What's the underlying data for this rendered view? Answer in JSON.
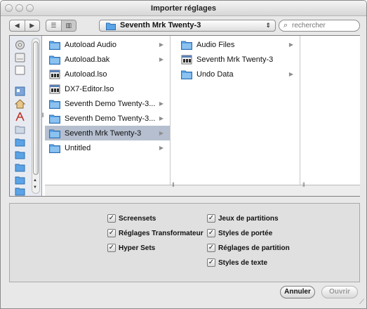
{
  "window": {
    "title": "Importer réglages"
  },
  "toolbar": {
    "back_glyph": "◀",
    "forward_glyph": "▶",
    "list_view_glyph": "☰",
    "column_view_glyph": "▥",
    "location": "Seventh Mrk Twenty-3",
    "location_arrows": "⇕",
    "search_placeholder": "rechercher"
  },
  "column1": [
    {
      "label": "Autoload Audio",
      "icon": "folder-icon",
      "has_children": true,
      "selected": false
    },
    {
      "label": "Autoload.bak",
      "icon": "folder-icon",
      "has_children": true,
      "selected": false
    },
    {
      "label": "Autoload.lso",
      "icon": "document-icon",
      "has_children": false,
      "selected": false
    },
    {
      "label": "DX7-Editor.lso",
      "icon": "document-icon",
      "has_children": false,
      "selected": false
    },
    {
      "label": "Seventh Demo Twenty-3...",
      "icon": "folder-icon",
      "has_children": true,
      "selected": false
    },
    {
      "label": "Seventh Demo Twenty-3...",
      "icon": "folder-icon",
      "has_children": true,
      "selected": false
    },
    {
      "label": "Seventh Mrk Twenty-3",
      "icon": "folder-icon",
      "has_children": true,
      "selected": true
    },
    {
      "label": "Untitled",
      "icon": "folder-icon",
      "has_children": true,
      "selected": false
    }
  ],
  "column2": [
    {
      "label": "Audio Files",
      "icon": "folder-icon",
      "has_children": true,
      "selected": false
    },
    {
      "label": "Seventh Mrk Twenty-3",
      "icon": "document-icon",
      "has_children": false,
      "selected": false
    },
    {
      "label": "Undo Data",
      "icon": "folder-icon",
      "has_children": true,
      "selected": false
    }
  ],
  "options": {
    "left": [
      {
        "label": "Screensets",
        "checked": true
      },
      {
        "label": "Réglages Transformateur",
        "checked": true
      },
      {
        "label": "Hyper Sets",
        "checked": true
      }
    ],
    "right": [
      {
        "label": "Jeux de partitions",
        "checked": true
      },
      {
        "label": "Styles de portée",
        "checked": true
      },
      {
        "label": "Réglages de partition",
        "checked": true
      },
      {
        "label": "Styles de texte",
        "checked": true
      }
    ]
  },
  "buttons": {
    "cancel": "Annuler",
    "open": "Ouvrir"
  },
  "colors": {
    "selection": "#b5bfcf",
    "folder": "#5ba3e6",
    "sidebar": "#e7ebf1"
  }
}
